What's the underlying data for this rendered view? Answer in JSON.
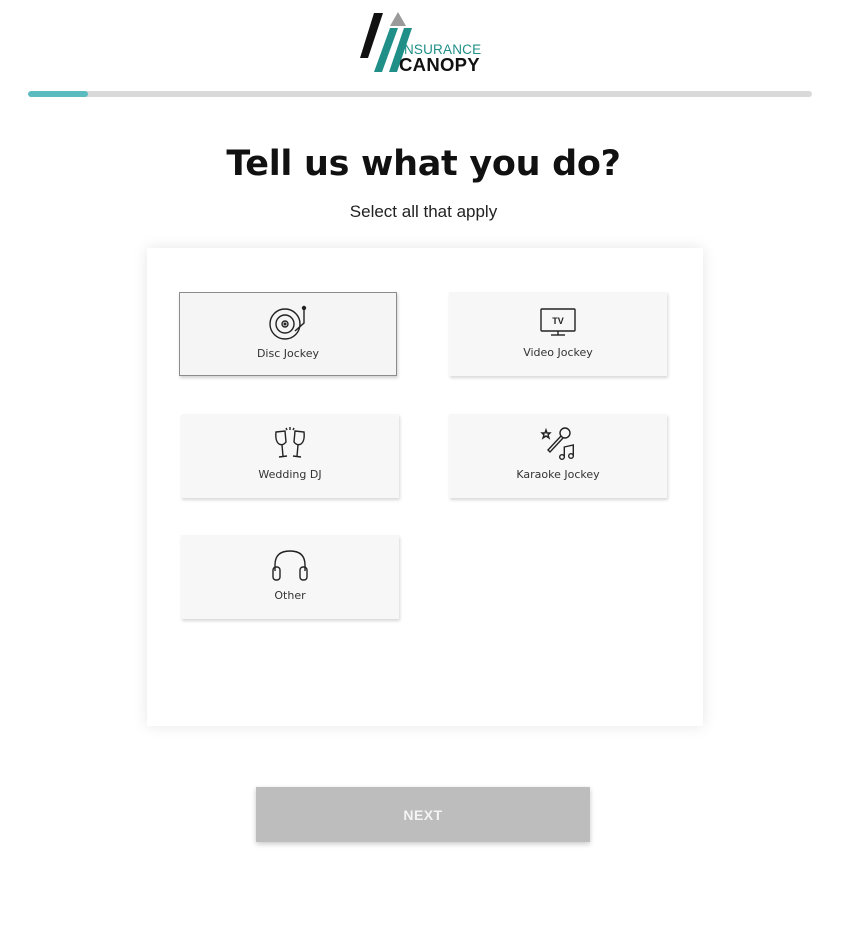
{
  "brand": {
    "line1": "INSURANCE",
    "line2": "CANOPY",
    "colors": {
      "teal": "#1f8f87",
      "dark": "#111111",
      "gray": "#9a9a9a"
    }
  },
  "progress": {
    "value_percent": 7.6,
    "color": "#5bbcc0",
    "track_color": "#d9d9d9"
  },
  "heading": {
    "title": "Tell us what you do?",
    "subtitle": "Select all that apply"
  },
  "options": [
    {
      "label": "Disc Jockey",
      "icon": "turntable-icon",
      "selected": true
    },
    {
      "label": "Video Jockey",
      "icon": "tv-icon",
      "selected": false
    },
    {
      "label": "Wedding DJ",
      "icon": "champagne-glasses-icon",
      "selected": false
    },
    {
      "label": "Karaoke Jockey",
      "icon": "karaoke-mic-icon",
      "selected": false
    },
    {
      "label": "Other",
      "icon": "headphones-icon",
      "selected": false
    }
  ],
  "next_button": {
    "label": "NEXT",
    "enabled": false,
    "color": "#bdbdbd"
  }
}
